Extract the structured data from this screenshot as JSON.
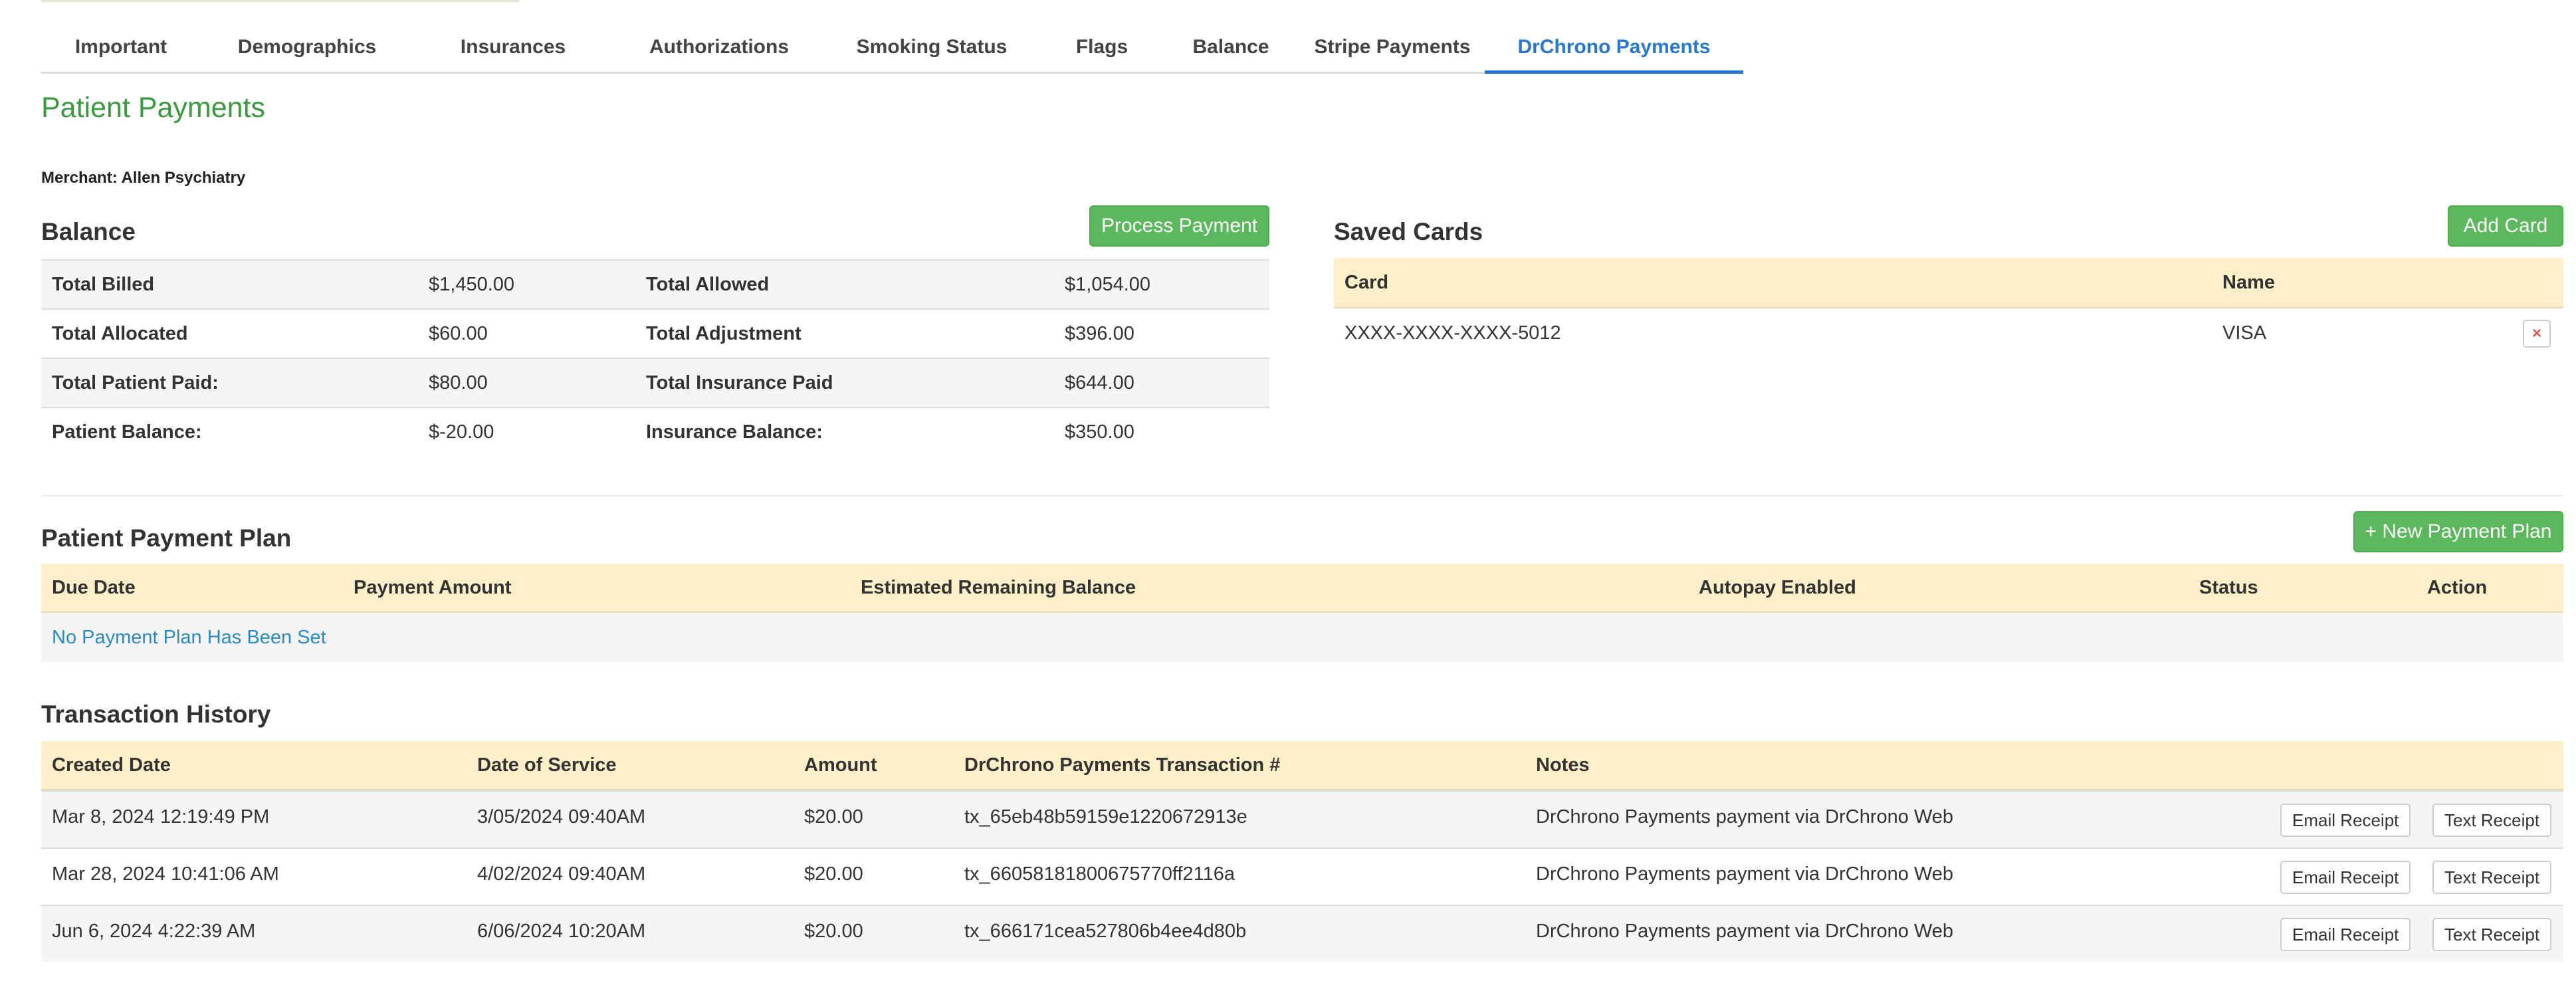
{
  "tabs": [
    "Important",
    "Demographics",
    "Insurances",
    "Authorizations",
    "Smoking Status",
    "Flags",
    "Balance",
    "Stripe Payments",
    "DrChrono Payments"
  ],
  "active_tab": "DrChrono Payments",
  "page_title": "Patient Payments",
  "merchant": "Merchant: Allen Psychiatry",
  "balance": {
    "title": "Balance",
    "process_button": "Process Payment",
    "rows": [
      {
        "l1": "Total Billed",
        "v1": "$1,450.00",
        "l2": "Total Allowed",
        "v2": "$1,054.00"
      },
      {
        "l1": "Total Allocated",
        "v1": "$60.00",
        "l2": "Total Adjustment",
        "v2": "$396.00"
      },
      {
        "l1": "Total Patient Paid:",
        "v1": "$80.00",
        "l2": "Total Insurance Paid",
        "v2": "$644.00"
      },
      {
        "l1": "Patient Balance:",
        "v1": "$-20.00",
        "l2": "Insurance Balance:",
        "v2": "$350.00"
      }
    ]
  },
  "saved_cards": {
    "title": "Saved Cards",
    "add_button": "Add Card",
    "headers": {
      "card": "Card",
      "name": "Name"
    },
    "rows": [
      {
        "card": "XXXX-XXXX-XXXX-5012",
        "name": "VISA"
      }
    ],
    "delete_glyph": "×"
  },
  "payment_plan": {
    "title": "Patient Payment Plan",
    "new_button": "+ New Payment Plan",
    "headers": [
      "Due Date",
      "Payment Amount",
      "Estimated Remaining Balance",
      "Autopay Enabled",
      "Status",
      "Action"
    ],
    "empty_text": "No Payment Plan Has Been Set"
  },
  "transactions": {
    "title": "Transaction History",
    "headers": [
      "Created Date",
      "Date of Service",
      "Amount",
      "DrChrono Payments Transaction #",
      "Notes"
    ],
    "email_button": "Email Receipt",
    "text_button": "Text Receipt",
    "rows": [
      {
        "created": "Mar 8, 2024 12:19:49 PM",
        "service": "3/05/2024 09:40AM",
        "amount": "$20.00",
        "txn": "tx_65eb48b59159e1220672913e",
        "notes": "DrChrono Payments payment via DrChrono Web"
      },
      {
        "created": "Mar 28, 2024 10:41:06 AM",
        "service": "4/02/2024 09:40AM",
        "amount": "$20.00",
        "txn": "tx_66058181800675770ff2116a",
        "notes": "DrChrono Payments payment via DrChrono Web"
      },
      {
        "created": "Jun 6, 2024 4:22:39 AM",
        "service": "6/06/2024 10:20AM",
        "amount": "$20.00",
        "txn": "tx_666171cea527806b4ee4d80b",
        "notes": "DrChrono Payments payment via DrChrono Web"
      }
    ]
  }
}
